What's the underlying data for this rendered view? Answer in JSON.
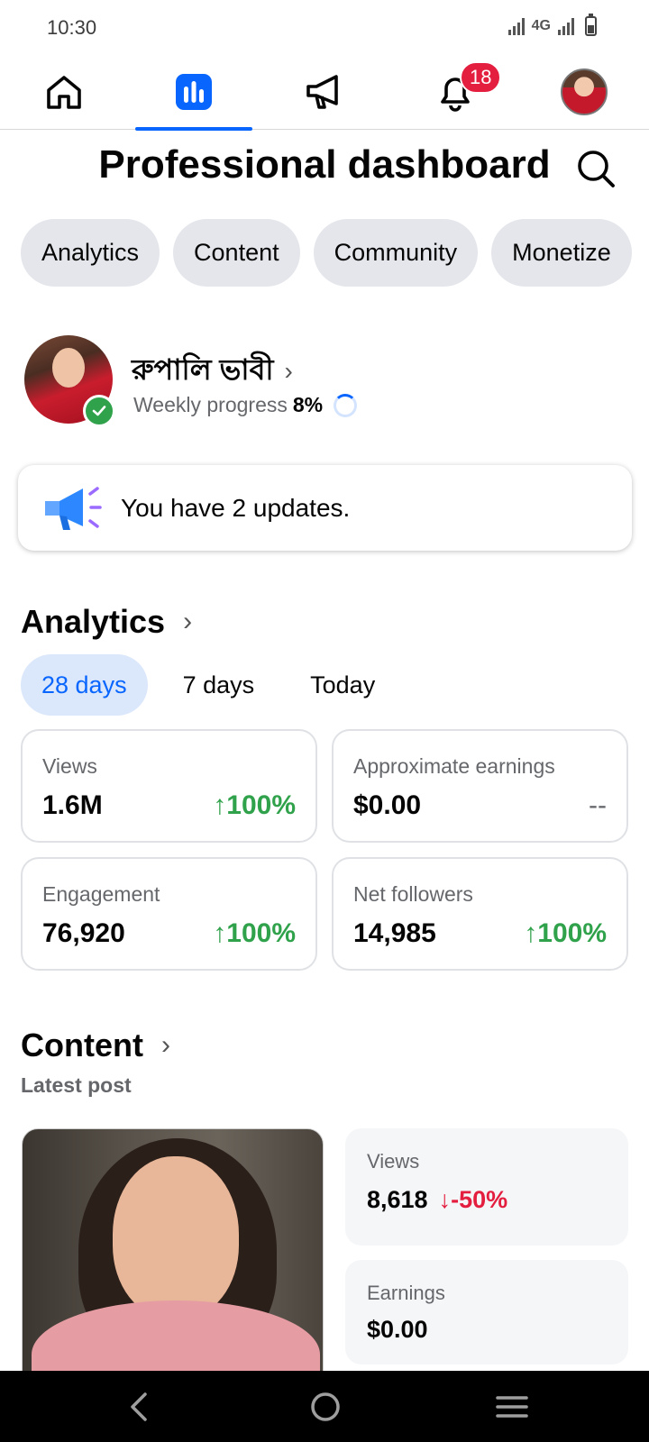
{
  "status_bar": {
    "time": "10:30",
    "network_label": "4G"
  },
  "nav": {
    "items": [
      {
        "icon": "home-icon"
      },
      {
        "icon": "bar-chart-icon",
        "active": true
      },
      {
        "icon": "megaphone-icon"
      },
      {
        "icon": "bell-icon",
        "badge": "18"
      },
      {
        "icon": "profile-avatar"
      }
    ]
  },
  "header": {
    "title": "Professional dashboard"
  },
  "chips": [
    "Analytics",
    "Content",
    "Community",
    "Monetize"
  ],
  "profile": {
    "name": "রুপালি ভাবী",
    "weekly_label": "Weekly progress",
    "weekly_value": "8%",
    "verified": true
  },
  "updates": {
    "text": "You have 2 updates."
  },
  "analytics": {
    "title": "Analytics",
    "tabs": [
      "28 days",
      "7 days",
      "Today"
    ],
    "active_tab": "28 days",
    "metrics": [
      {
        "label": "Views",
        "value": "1.6M",
        "delta": "100%",
        "trend": "up"
      },
      {
        "label": "Approximate earnings",
        "value": "$0.00",
        "delta": "--",
        "trend": "none"
      },
      {
        "label": "Engagement",
        "value": "76,920",
        "delta": "100%",
        "trend": "up"
      },
      {
        "label": "Net followers",
        "value": "14,985",
        "delta": "100%",
        "trend": "up"
      }
    ]
  },
  "content": {
    "title": "Content",
    "subtitle": "Latest post",
    "views_label": "Views",
    "views_value": "8,618",
    "views_delta": "-50%",
    "earnings_label": "Earnings",
    "earnings_value": "$0.00"
  },
  "colors": {
    "accent": "#0866ff",
    "positive": "#31a24c",
    "negative": "#e41e3f",
    "chip_bg": "#e4e6eb"
  }
}
